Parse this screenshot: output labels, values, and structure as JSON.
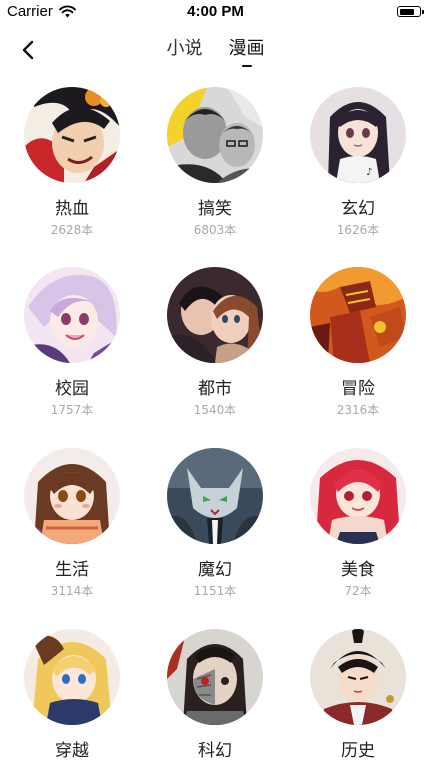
{
  "status_bar": {
    "carrier": "Carrier",
    "time": "4:00 PM",
    "battery_level": 0.85
  },
  "nav": {
    "tabs": [
      {
        "label": "小说",
        "active": false
      },
      {
        "label": "漫画",
        "active": true
      }
    ]
  },
  "genres": [
    {
      "name": "热血",
      "count": "2628本",
      "art": "fiery"
    },
    {
      "name": "搞笑",
      "count": "6803本",
      "art": "grayscale"
    },
    {
      "name": "玄幻",
      "count": "1626本",
      "art": "dark-hair-girl"
    },
    {
      "name": "校园",
      "count": "1757本",
      "art": "pastel-girl"
    },
    {
      "name": "都市",
      "count": "1540本",
      "art": "couple"
    },
    {
      "name": "冒险",
      "count": "2316本",
      "art": "mecha-orange"
    },
    {
      "name": "生活",
      "count": "3114本",
      "art": "brown-hair-girl"
    },
    {
      "name": "魔幻",
      "count": "1151本",
      "art": "cat-mask"
    },
    {
      "name": "美食",
      "count": "72本",
      "art": "red-hair-girl"
    },
    {
      "name": "穿越",
      "count": "",
      "art": "blonde-girl"
    },
    {
      "name": "科幻",
      "count": "",
      "art": "cyborg"
    },
    {
      "name": "历史",
      "count": "",
      "art": "samurai"
    }
  ],
  "colors": {
    "accent": "#111111",
    "count_text": "#a8a8a8"
  }
}
